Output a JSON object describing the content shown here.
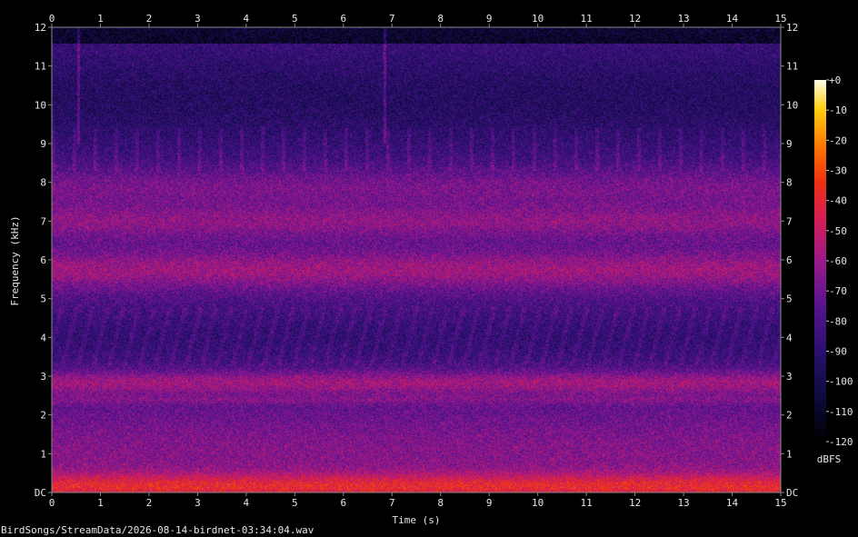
{
  "filename": "BirdSongs/StreamData/2026-08-14-birdnet-03:34:04.wav",
  "chart_data": {
    "type": "heatmap",
    "xlabel": "Time (s)",
    "ylabel": "Frequency (kHz)",
    "x_ticks": [
      "0",
      "1",
      "2",
      "3",
      "4",
      "5",
      "6",
      "7",
      "8",
      "9",
      "10",
      "11",
      "12",
      "13",
      "14",
      "15"
    ],
    "y_ticks": [
      "DC",
      "1",
      "2",
      "3",
      "4",
      "5",
      "6",
      "7",
      "8",
      "9",
      "10",
      "11",
      "12"
    ],
    "xlim": [
      0,
      15
    ],
    "ylim": [
      0,
      12
    ],
    "colorbar": {
      "label": "dBFS",
      "range": [
        -120,
        0
      ],
      "ticks": [
        "+0",
        "-10",
        "-20",
        "-30",
        "-40",
        "-50",
        "-60",
        "-70",
        "-80",
        "-90",
        "-100",
        "-110",
        "-120"
      ]
    },
    "bands": [
      {
        "f_low": 0.0,
        "f_high": 0.5,
        "level": "high"
      },
      {
        "f_low": 0.5,
        "f_high": 2.0,
        "level": "medium-high"
      },
      {
        "f_low": 2.6,
        "f_high": 3.1,
        "level": "high"
      },
      {
        "f_low": 3.3,
        "f_high": 4.8,
        "level": "low"
      },
      {
        "f_low": 5.4,
        "f_high": 6.1,
        "level": "high"
      },
      {
        "f_low": 6.7,
        "f_high": 7.3,
        "level": "high"
      },
      {
        "f_low": 7.5,
        "f_high": 8.3,
        "level": "medium-high"
      },
      {
        "f_low": 9.0,
        "f_high": 11.8,
        "level": "low"
      }
    ],
    "transients_s": [
      0.55,
      6.85
    ]
  }
}
